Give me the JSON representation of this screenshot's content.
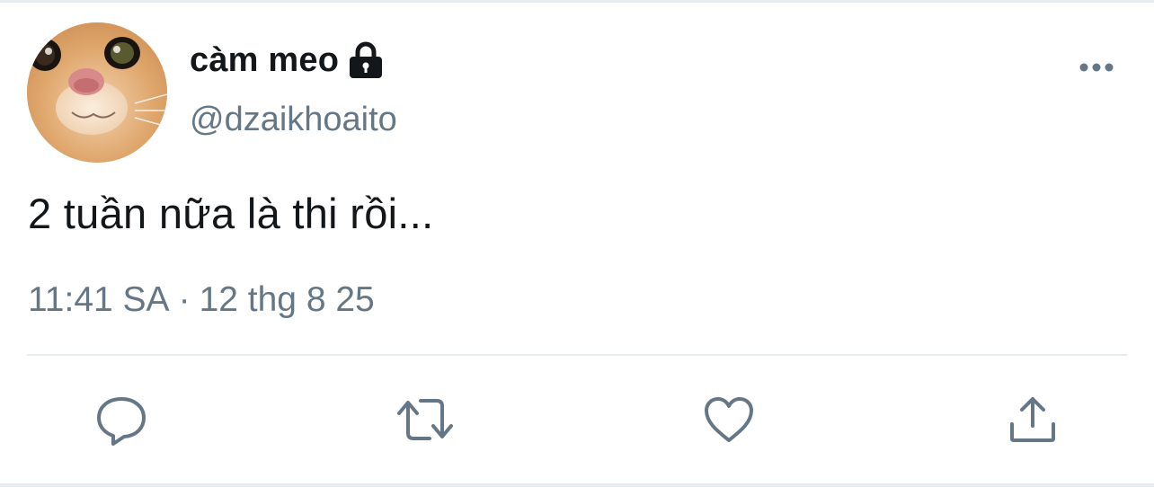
{
  "author": {
    "display_name": "càm meo",
    "handle": "@dzaikhoaito",
    "avatar_icon": "cat-face-photo",
    "protected_icon": "lock-icon"
  },
  "tweet": {
    "text": "2 tuần nữa là thi rồi...",
    "time": "11:41 SA",
    "separator": "·",
    "date": "12 thg 8 25"
  },
  "actions": [
    {
      "name": "reply",
      "icon": "reply-bubble-icon"
    },
    {
      "name": "retweet",
      "icon": "retweet-icon"
    },
    {
      "name": "like",
      "icon": "heart-icon"
    },
    {
      "name": "share",
      "icon": "share-upload-icon"
    }
  ],
  "colors": {
    "text_primary": "#14171a",
    "text_secondary": "#657786",
    "icon": "#657786",
    "divider": "#e6ecf0",
    "background": "#ffffff"
  }
}
